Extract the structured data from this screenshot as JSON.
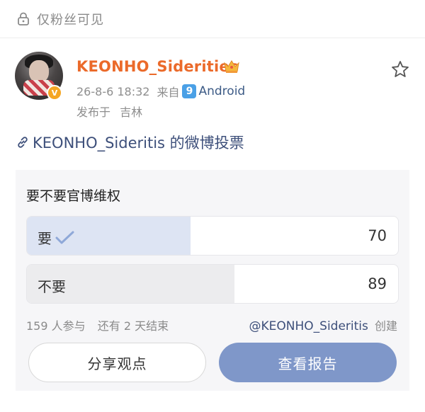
{
  "visibility": {
    "label": "仅粉丝可见",
    "icon": "lock-icon"
  },
  "post": {
    "username": "KEONHO_Siderities",
    "time": "26-8-6 18:32",
    "from_label": "来自",
    "device_badge": "9",
    "device": "Android",
    "location_prefix": "发布于",
    "location": "吉林",
    "verified_badge": "V",
    "link_text": "KEONHO_Sideritis 的微博投票"
  },
  "poll": {
    "title": "要不要官博维权",
    "options": [
      {
        "label": "要",
        "votes": "70",
        "selected": true,
        "share": 0.44
      },
      {
        "label": "不要",
        "votes": "89",
        "selected": false,
        "share": 0.56
      }
    ],
    "participants": "159 人参与",
    "remaining": "还有 2 天结束",
    "creator_handle": "@KEONHO_Sideritis",
    "creator_suffix": "创建",
    "share_button": "分享观点",
    "report_button": "查看报告"
  },
  "colors": {
    "username": "#eb6a2a",
    "link": "#3d4f7a",
    "selected_fill": "#dde4f3",
    "report_button": "#7f97c9"
  }
}
